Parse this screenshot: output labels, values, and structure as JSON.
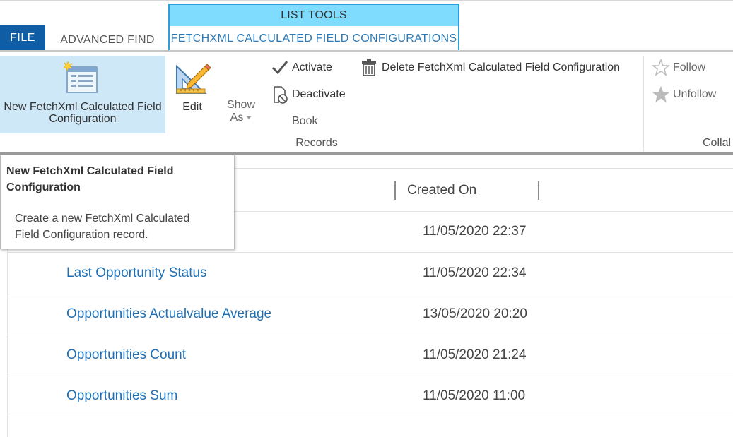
{
  "tabs": {
    "file": "FILE",
    "advanced_find": "ADVANCED FIND",
    "contextual_group": "LIST TOOLS",
    "contextual_tab": "FETCHXML CALCULATED FIELD CONFIGURATIONS"
  },
  "ribbon": {
    "new_label_line1": "New FetchXml Calculated Field",
    "new_label_line2": "Configuration",
    "edit": "Edit",
    "show_as_line1": "Show",
    "show_as_line2": "As",
    "activate": "Activate",
    "deactivate": "Deactivate",
    "book": "Book",
    "delete": "Delete FetchXml Calculated Field Configuration",
    "follow": "Follow",
    "unfollow": "Unfollow",
    "records_group": "Records",
    "collab_group": "Collal"
  },
  "tooltip": {
    "title_line1": "New FetchXml Calculated Field",
    "title_line2": "Configuration",
    "desc_line1": "Create a new FetchXml Calculated",
    "desc_line2": "Field Configuration record."
  },
  "grid": {
    "created_on_header": "Created On",
    "rows": [
      {
        "name": "",
        "created_on": "11/05/2020 22:37"
      },
      {
        "name": "Last Opportunity Status",
        "created_on": "11/05/2020 22:34"
      },
      {
        "name": "Opportunities Actualvalue Average",
        "created_on": "13/05/2020 20:20"
      },
      {
        "name": "Opportunities Count",
        "created_on": "11/05/2020 21:24"
      },
      {
        "name": "Opportunities Sum",
        "created_on": "11/05/2020 11:00"
      }
    ]
  },
  "colors": {
    "file_tab": "#0f5da5",
    "contextual_header": "#80dcff",
    "contextual_border": "#2aa0d6",
    "selected_button": "#cfe8f8",
    "link": "#1f6fb5"
  },
  "icons": [
    "new-record-icon",
    "edit-icon",
    "checkmark-icon",
    "deactivate-icon",
    "trash-icon",
    "star-outline-icon",
    "star-filled-icon"
  ]
}
